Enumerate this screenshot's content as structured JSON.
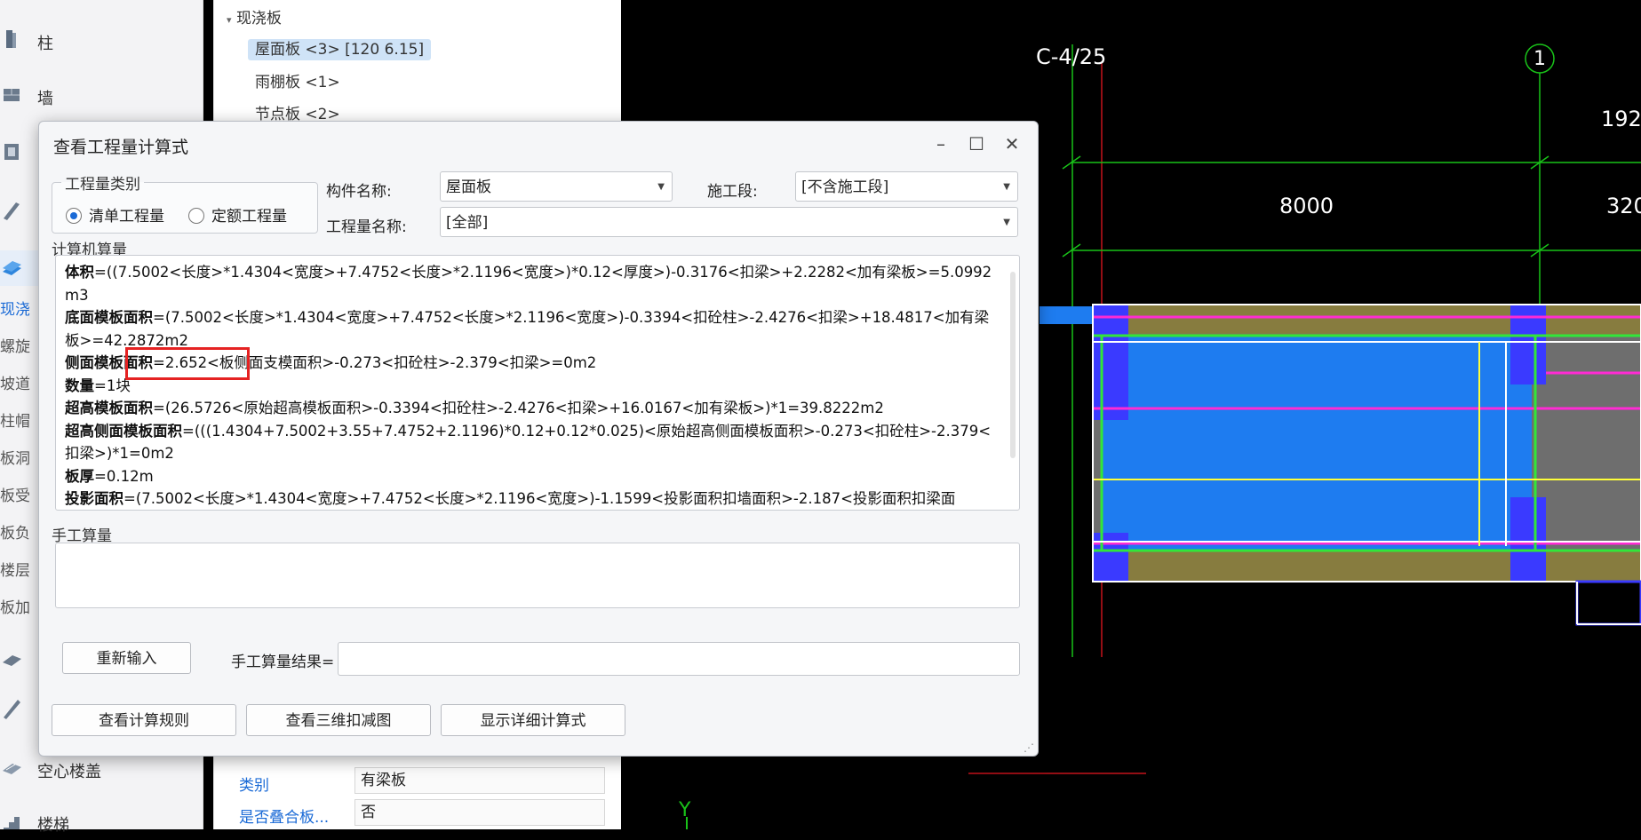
{
  "sidebar": {
    "items": [
      {
        "label": "柱"
      },
      {
        "label": "墙"
      },
      {
        "label": ""
      },
      {
        "label": ""
      },
      {
        "label": ""
      },
      {
        "label": "空心楼盖"
      },
      {
        "label": "楼梯"
      }
    ],
    "sub_items": [
      {
        "label": "现浇"
      },
      {
        "label": "螺旋"
      },
      {
        "label": "坡道"
      },
      {
        "label": "柱帽"
      },
      {
        "label": "板洞"
      },
      {
        "label": "板受"
      },
      {
        "label": "板负"
      },
      {
        "label": "楼层"
      },
      {
        "label": "板加"
      }
    ]
  },
  "tree": {
    "group": "现浇板",
    "nodes": [
      {
        "label": "屋面板 <3> [120 6.15]"
      },
      {
        "label": "雨棚板 <1>"
      },
      {
        "label": "节点板 <2>"
      }
    ],
    "properties": [
      {
        "name": "类别",
        "value": "有梁板"
      },
      {
        "name": "是否叠合板...",
        "value": "否"
      }
    ]
  },
  "cad": {
    "axis_label_left": "C-4/25",
    "axis_label_right": "1",
    "dim_top": "192",
    "dim_mid": "8000",
    "dim_right": "320",
    "y_axis": "Y"
  },
  "dialog": {
    "title": "查看工程量计算式",
    "category_group": "工程量类别",
    "radio_bill": "清单工程量",
    "radio_quota": "定额工程量",
    "component_name_label": "构件名称:",
    "component_name_value": "屋面板",
    "stage_label": "施工段:",
    "stage_value": "[不含施工段]",
    "quantity_name_label": "工程量名称:",
    "quantity_name_value": "[全部]",
    "computer_calc_group": "计算机算量",
    "formulas": [
      {
        "name": "体积",
        "expr": "=((7.5002<长度>*1.4304<宽度>+7.4752<长度>*2.1196<宽度>)*0.12<厚度>)-0.3176<扣梁>+2.2282<加有梁板>=5.0992m3"
      },
      {
        "name": "底面模板面积",
        "expr": "=(7.5002<长度>*1.4304<宽度>+7.4752<长度>*2.1196<宽度>)-0.3394<扣砼柱>-2.4276<扣梁>+18.4817<加有梁板>=42.2872m2"
      },
      {
        "name": "侧面模板面积",
        "expr": "=2.652<板侧面支模面积>-0.273<扣砼柱>-2.379<扣梁>=0m2"
      },
      {
        "name": "数量",
        "expr": "=1块"
      },
      {
        "name": "超高模板面积",
        "expr": "=(26.5726<原始超高模板面积>-0.3394<扣砼柱>-2.4276<扣梁>+16.0167<加有梁板>)*1=39.8222m2"
      },
      {
        "name": "超高侧面模板面积",
        "expr": "=(((1.4304+7.5002+3.55+7.4752+2.1196)*0.12+0.12*0.025)<原始超高侧面模板面积>-0.273<扣砼柱>-2.379<扣梁>)*1=0m2"
      },
      {
        "name": "板厚",
        "expr": "=0.12m"
      },
      {
        "name": "投影面积",
        "expr": "=(7.5002<长度>*1.4304<宽度>+7.4752<长度>*2.1196<宽度>)-1.1599<投影面积扣墙面积>-2.187<投影面积扣梁面"
      }
    ],
    "manual_calc_group": "手工算量",
    "reinput_button": "重新输入",
    "manual_result_label": "手工算量结果=",
    "view_rules_button": "查看计算规则",
    "view_3d_button": "查看三维扣减图",
    "show_detail_button": "显示详细计算式"
  },
  "colors": {
    "accent": "#1a6ad6",
    "highlight": "#e52222"
  }
}
